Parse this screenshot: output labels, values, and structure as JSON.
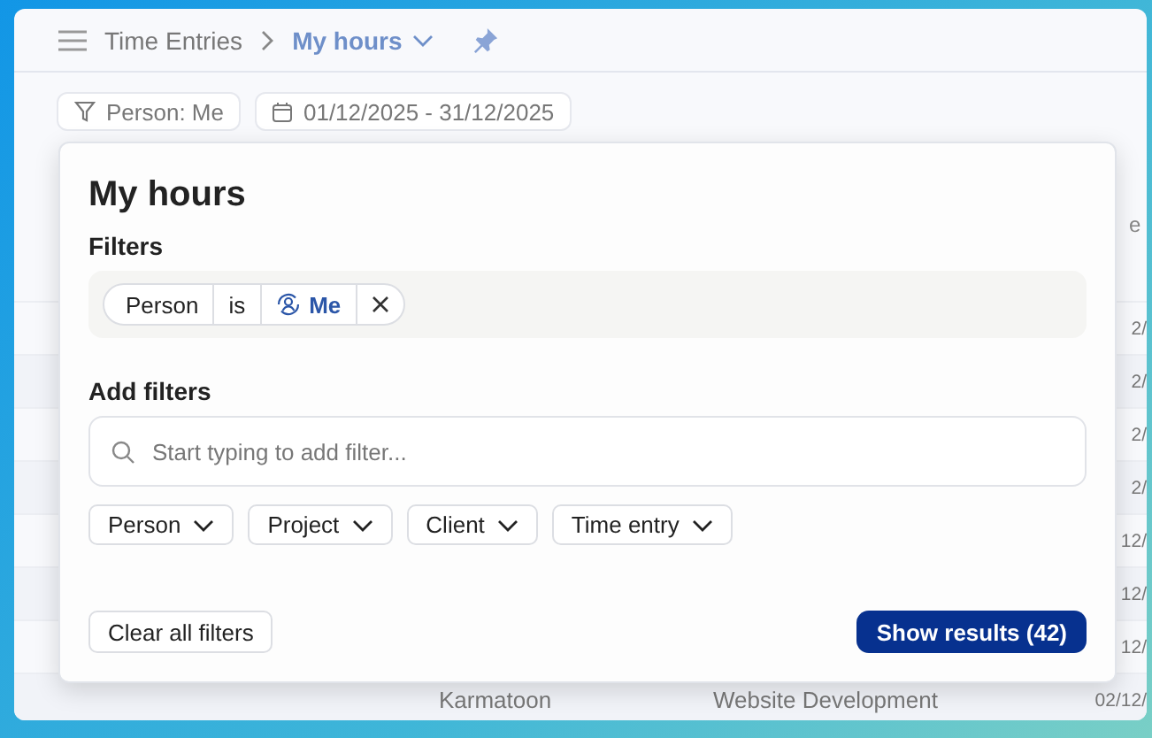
{
  "breadcrumb": {
    "parent": "Time Entries",
    "current": "My hours"
  },
  "toolbar": {
    "person_filter": "Person: Me",
    "date_range": "01/12/2025 - 31/12/2025"
  },
  "table": {
    "header_fragment": "e",
    "rows": [
      {
        "column_3": "2/"
      },
      {
        "column_3": "2/"
      },
      {
        "column_3": "2/"
      },
      {
        "column_3": "2/"
      },
      {
        "column_3": "12/"
      },
      {
        "column_3": "12/"
      },
      {
        "column_3": "12/"
      },
      {
        "column_1": "Karmatoon",
        "column_2": "Website Development",
        "column_3": "02/12/"
      }
    ]
  },
  "popover": {
    "title": "My hours",
    "filters_label": "Filters",
    "active_filter": {
      "field": "Person",
      "operator": "is",
      "value": "Me"
    },
    "add_filters_label": "Add filters",
    "search": {
      "placeholder": "Start typing to add filter..."
    },
    "filter_options": [
      "Person",
      "Project",
      "Client",
      "Time entry"
    ],
    "clear_button": "Clear all filters",
    "show_button": "Show results (42)"
  }
}
